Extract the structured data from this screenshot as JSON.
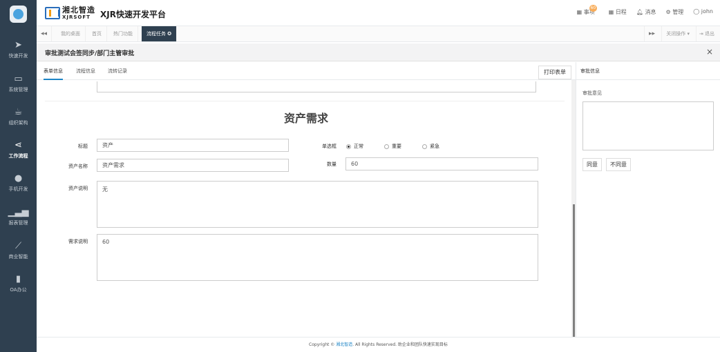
{
  "sidebar": {
    "items": [
      {
        "label": "快速开发",
        "icon": "paper-plane-icon"
      },
      {
        "label": "系统管理",
        "icon": "monitor-icon"
      },
      {
        "label": "组织架构",
        "icon": "coffee-icon"
      },
      {
        "label": "工作流程",
        "icon": "share-icon"
      },
      {
        "label": "手机开发",
        "icon": "android-icon"
      },
      {
        "label": "报表管理",
        "icon": "area-chart-icon"
      },
      {
        "label": "商业智能",
        "icon": "line-chart-icon"
      },
      {
        "label": "OA办公",
        "icon": "bookmark-icon"
      }
    ]
  },
  "header": {
    "logo_cn": "湘北智造",
    "logo_en": "XJRSOFT",
    "app_title": "XJR快速开发平台",
    "todo_label": "事项",
    "todo_badge": "60",
    "schedule_label": "日程",
    "message_label": "消息",
    "manage_label": "管理",
    "user_label": "john"
  },
  "tabsbar": {
    "prev": "◂◂",
    "tabs": [
      "我的桌面",
      "首页",
      "热门功能",
      "流程任务"
    ],
    "next": "▸▸",
    "close_ops": "关闭操作",
    "logout": "退出"
  },
  "window": {
    "title": "审批测试会签同步/部门主管审批",
    "close": "×"
  },
  "content_tabs": [
    "表单信息",
    "流程信息",
    "流转记录"
  ],
  "print_button": "打印表单",
  "form": {
    "title": "资产需求",
    "title_label": "标题",
    "title_value": "资产",
    "radio_label": "单选框",
    "radio_options": [
      "正常",
      "重要",
      "紧急"
    ],
    "radio_selected": "正常",
    "asset_name_label": "资产名称",
    "asset_name_value": "资产需求",
    "quantity_label": "数量",
    "quantity_value": "60",
    "asset_desc_label": "资产说明",
    "asset_desc_value": "无",
    "demand_desc_label": "需求说明",
    "demand_desc_value": "60"
  },
  "approval": {
    "header": "审批信息",
    "opinion_label": "审批意见",
    "agree": "同意",
    "disagree": "不同意"
  },
  "footer": {
    "prefix": "Copyright © ",
    "brand": "湘北智造",
    "suffix": ". All Rights Reserved. 助企业和团队快速实现目标"
  }
}
